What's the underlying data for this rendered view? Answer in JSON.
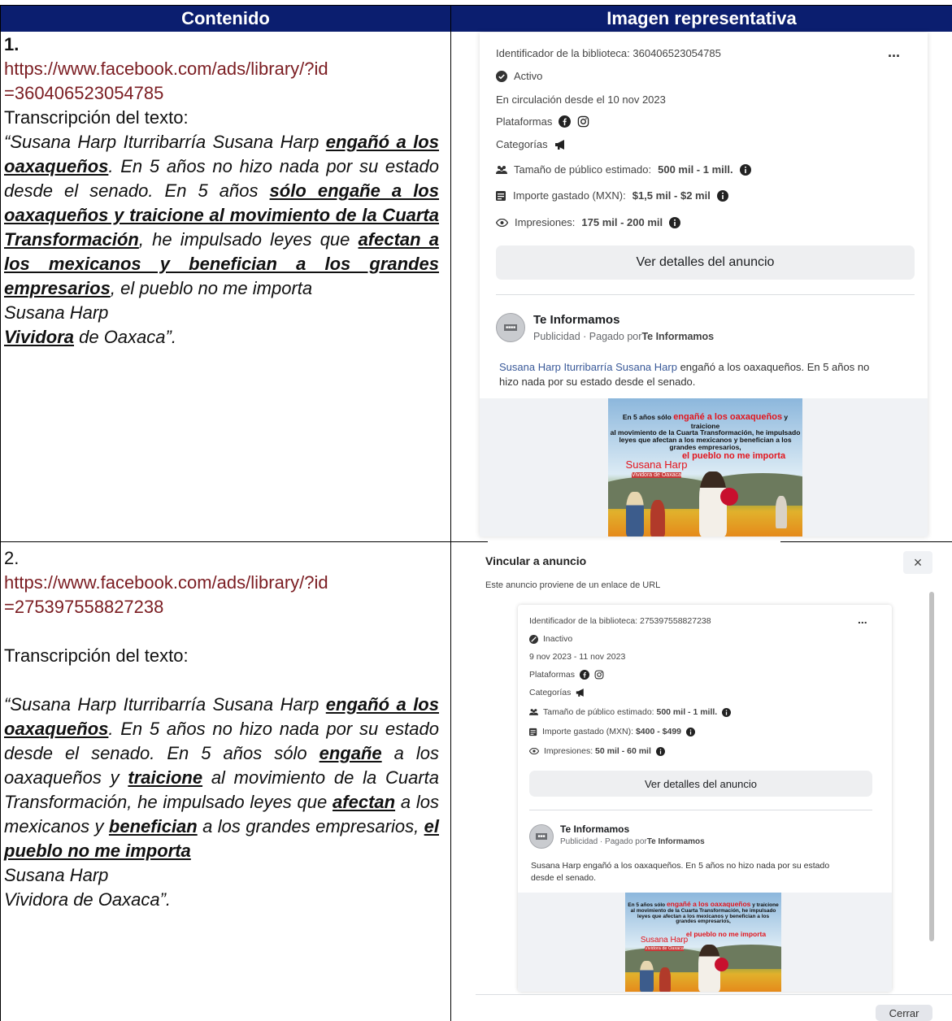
{
  "table": {
    "col1_header": "Contenido",
    "col2_header": "Imagen representativa"
  },
  "row1": {
    "number": "1.",
    "url_line1": "https://www.facebook.com/ads/library/?id",
    "url_line2": "=360406523054785",
    "transcription_label": "Transcripción del texto:",
    "quote": [
      {
        "t": "“Susana Harp Iturribarría Susana Harp ",
        "b": false
      },
      {
        "t": "engañó a los oaxaqueños",
        "b": true
      },
      {
        "t": ". En 5 años no hizo nada por su estado desde el senado. En 5 años ",
        "b": false
      },
      {
        "t": "sólo engañe a los oaxaqueños y traicione al movimiento de la Cuarta Transformación",
        "b": true
      },
      {
        "t": ", he impulsado leyes que ",
        "b": false
      },
      {
        "t": "afectan a los mexicanos y benefician a los grandes empresarios",
        "b": true
      },
      {
        "t": ", el pueblo no me importa",
        "b": false
      }
    ],
    "sign1": "Susana Harp",
    "sign2_bold": "Vividora",
    "sign2_rest": " de Oaxaca”."
  },
  "row2": {
    "number": "2.",
    "url_line1": "https://www.facebook.com/ads/library/?id",
    "url_line2": "=275397558827238",
    "transcription_label": "Transcripción del texto:",
    "quote": [
      {
        "t": "“Susana Harp Iturribarría Susana Harp ",
        "b": false
      },
      {
        "t": "engañó a los oaxaqueños",
        "b": true
      },
      {
        "t": ". En 5 años no hizo nada por su estado desde el senado. En 5 años sólo ",
        "b": false
      },
      {
        "t": "engañe",
        "b": true
      },
      {
        "t": " a los oaxaqueños y ",
        "b": false
      },
      {
        "t": "traicione",
        "b": true
      },
      {
        "t": " al movimiento de la Cuarta Transformación, he impulsado leyes que ",
        "b": false
      },
      {
        "t": "afectan",
        "b": true
      },
      {
        "t": " a los mexicanos y ",
        "b": false
      },
      {
        "t": "benefician",
        "b": true
      },
      {
        "t": " a los grandes empresarios, ",
        "b": false
      },
      {
        "t": "el pueblo no me importa",
        "b": true
      }
    ],
    "sign1": "Susana Harp",
    "sign2": "Vividora de Oaxaca”."
  },
  "ad1": {
    "library_id": "Identificador de la biblioteca: 360406523054785",
    "more": "...",
    "status": "Activo",
    "circulation": "En circulación desde el 10 nov 2023",
    "platforms": "Plataformas",
    "categories": "Categorías",
    "audience_label": "Tamaño de público estimado: ",
    "audience_value": "500 mil - 1 mill.",
    "spent_label": "Importe gastado (MXN): ",
    "spent_value": "$1,5 mil - $2 mil",
    "impressions_label": "Impresiones: ",
    "impressions_value": "175 mil - 200 mil",
    "details_button": "Ver detalles del anuncio",
    "page_name": "Te Informamos",
    "sponsored_prefix": "Publicidad · Pagado por ",
    "sponsored_by": "Te Informamos",
    "body_link": "Susana Harp Iturribarría Susana Harp",
    "body_rest": " engañó a los oaxaqueños. En 5 años no",
    "body_line2": "hizo nada por su estado desde el senado."
  },
  "ad2": {
    "modal_title": "Vincular a anuncio",
    "modal_subtitle": "Este anuncio proviene de un enlace de URL",
    "close_icon": "×",
    "library_id": "Identificador de la biblioteca: 275397558827238",
    "more": "...",
    "status": "Inactivo",
    "dates": "9 nov 2023 - 11 nov 2023",
    "platforms": "Plataformas",
    "categories": "Categorías",
    "audience_label": "Tamaño de público estimado: ",
    "audience_value": "500 mil - 1 mill.",
    "spent_label": "Importe gastado (MXN): ",
    "spent_value": "$400 - $499",
    "impressions_label": "Impresiones: ",
    "impressions_value": "50 mil - 60 mil",
    "details_button": "Ver detalles del anuncio",
    "page_name": "Te Informamos",
    "sponsored_prefix": "Publicidad · Pagado por ",
    "sponsored_by": "Te Informamos",
    "body_line1": "Susana Harp engañó a los oaxaqueños. En 5 años no hizo nada por su estado",
    "body_line2": "desde el senado.",
    "close_button": "Cerrar"
  },
  "ad_image": {
    "line1a": "En 5 años sólo ",
    "line1b": "engañé a los oaxaqueños",
    "line1c": " y traicione",
    "line2": "al movimiento de la Cuarta Transformación, he impulsado",
    "line3": "leyes que afectan a los mexicanos y benefician a los",
    "line4": "grandes empresarios,",
    "line5": "el pueblo no me importa",
    "name": "Susana Harp",
    "tag": "Vividora de Oaxaca"
  }
}
